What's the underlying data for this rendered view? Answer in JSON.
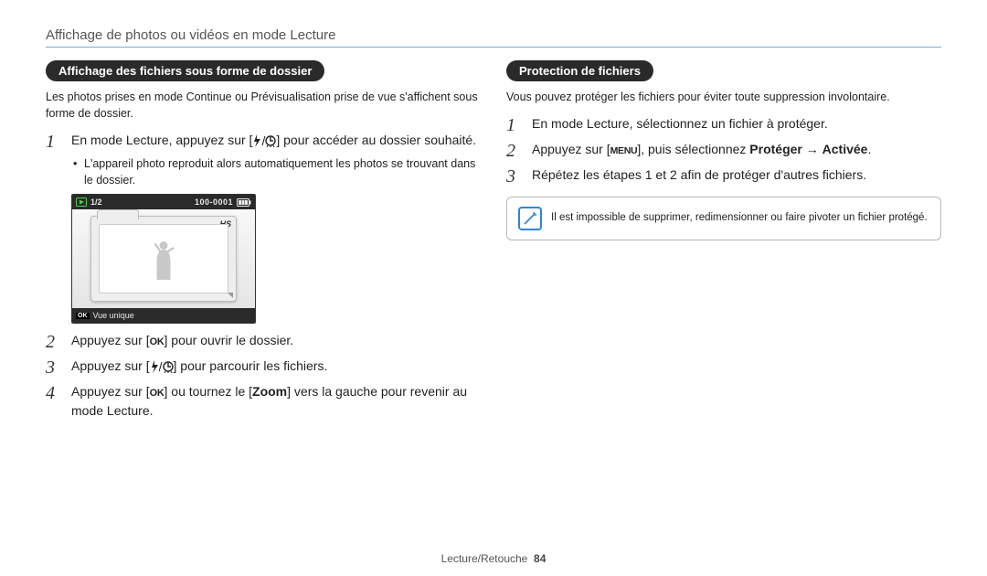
{
  "header": {
    "title": "Affichage de photos ou vidéos en mode Lecture"
  },
  "left": {
    "pill": "Affichage des fichiers sous forme de dossier",
    "intro": "Les photos prises en mode Continue ou Prévisualisation prise de vue s'affichent sous forme de dossier.",
    "step1_pre": "En mode Lecture, appuyez sur [",
    "step1_post": "] pour accéder au dossier souhaité.",
    "bullet1": "L'appareil photo reproduit alors automatiquement les photos se trouvant dans le dossier.",
    "step2_pre": "Appuyez sur [",
    "step2_post": "] pour ouvrir le dossier.",
    "step3_pre": "Appuyez sur [",
    "step3_post": "] pour parcourir les fichiers.",
    "step4_pre": "Appuyez sur [",
    "step4_mid": "] ou tournez le [",
    "step4_zoom": "Zoom",
    "step4_post": "] vers la gauche pour revenir au mode Lecture."
  },
  "camera": {
    "counter": "1/2",
    "file_no": "100-0001",
    "hs": "HS",
    "bottom_ok": "OK",
    "bottom_label": "Vue unique"
  },
  "right": {
    "pill": "Protection de fichiers",
    "intro": "Vous pouvez protéger les fichiers pour éviter toute suppression involontaire.",
    "step1": "En mode Lecture, sélectionnez un fichier à protéger.",
    "step2_pre": "Appuyez sur [",
    "step2_mid": "], puis sélectionnez ",
    "step2_proteger": "Protéger",
    "step2_arrow": " → ",
    "step2_activee": "Activée",
    "step2_post": ".",
    "step3": "Répétez les étapes 1 et 2 afin de protéger d'autres fichiers.",
    "note": "Il est impossible de supprimer, redimensionner ou faire pivoter un fichier protégé."
  },
  "icons": {
    "ok": "OK",
    "menu": "MENU"
  },
  "footer": {
    "section": "Lecture/Retouche",
    "page": "84"
  }
}
